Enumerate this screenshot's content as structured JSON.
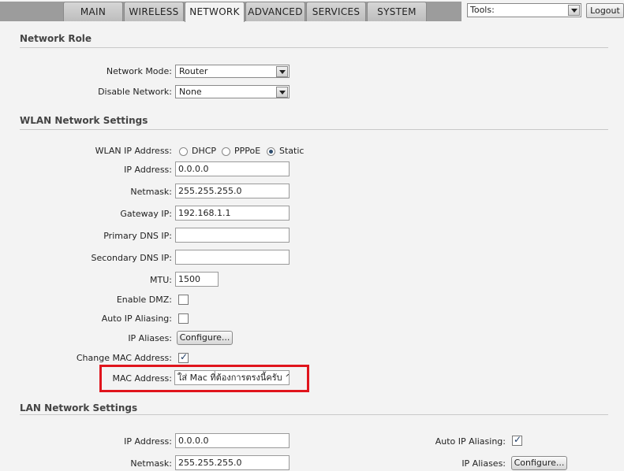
{
  "tabs": [
    "MAIN",
    "WIRELESS",
    "NETWORK",
    "ADVANCED",
    "SERVICES",
    "SYSTEM"
  ],
  "active_tab": "NETWORK",
  "tools": {
    "value": "Tools:"
  },
  "logout_label": "Logout",
  "network_role": {
    "title": "Network Role",
    "network_mode_label": "Network Mode:",
    "network_mode_value": "Router",
    "disable_network_label": "Disable Network:",
    "disable_network_value": "None"
  },
  "wlan": {
    "title": "WLAN Network Settings",
    "ip_address_mode_label": "WLAN IP Address:",
    "modes": [
      "DHCP",
      "PPPoE",
      "Static"
    ],
    "selected_mode": "Static",
    "ip_label": "IP Address:",
    "ip_value": "0.0.0.0",
    "netmask_label": "Netmask:",
    "netmask_value": "255.255.255.0",
    "gateway_label": "Gateway IP:",
    "gateway_value": "192.168.1.1",
    "primary_dns_label": "Primary DNS IP:",
    "primary_dns_value": "",
    "secondary_dns_label": "Secondary DNS IP:",
    "secondary_dns_value": "",
    "mtu_label": "MTU:",
    "mtu_value": "1500",
    "dmz_label": "Enable DMZ:",
    "dmz_checked": false,
    "auto_alias_label": "Auto IP Aliasing:",
    "auto_alias_checked": false,
    "ip_aliases_label": "IP Aliases:",
    "configure_label": "Configure...",
    "change_mac_label": "Change MAC Address:",
    "change_mac_checked": true,
    "mac_label": "MAC Address:",
    "mac_value": "ใส่ Mac ที่ต้องการตรงนี้ครับ ^^"
  },
  "lan": {
    "title": "LAN Network Settings",
    "ip_label": "IP Address:",
    "ip_value": "0.0.0.0",
    "netmask_label": "Netmask:",
    "netmask_value": "255.255.255.0",
    "auto_alias_label": "Auto IP Aliasing:",
    "auto_alias_checked": true,
    "ip_aliases_label": "IP Aliases:",
    "configure_label": "Configure..."
  },
  "colors": {
    "highlight_border": "#e0141c",
    "check_mark": "#1f3d66"
  }
}
